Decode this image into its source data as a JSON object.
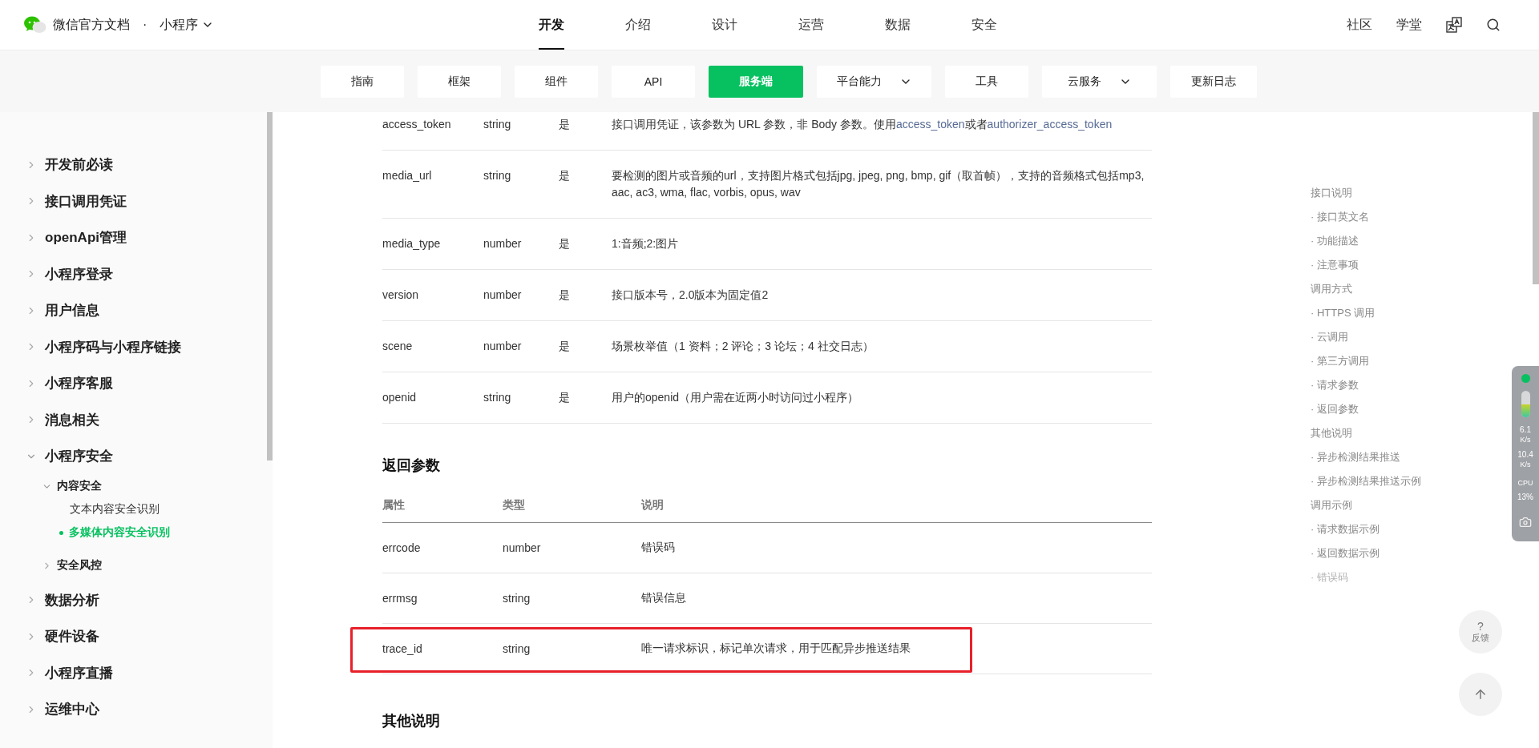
{
  "header": {
    "site_title": "微信官方文档",
    "separator": "·",
    "product": "小程序",
    "nav": [
      {
        "label": "开发",
        "selected": true
      },
      {
        "label": "介绍",
        "selected": false
      },
      {
        "label": "设计",
        "selected": false
      },
      {
        "label": "运营",
        "selected": false
      },
      {
        "label": "数据",
        "selected": false
      },
      {
        "label": "安全",
        "selected": false
      }
    ],
    "links": [
      "社区",
      "学堂"
    ]
  },
  "subnav": [
    {
      "label": "指南",
      "selected": false,
      "dropdown": false
    },
    {
      "label": "框架",
      "selected": false,
      "dropdown": false
    },
    {
      "label": "组件",
      "selected": false,
      "dropdown": false
    },
    {
      "label": "API",
      "selected": false,
      "dropdown": false
    },
    {
      "label": "服务端",
      "selected": true,
      "dropdown": false
    },
    {
      "label": "平台能力",
      "selected": false,
      "dropdown": true
    },
    {
      "label": "工具",
      "selected": false,
      "dropdown": false
    },
    {
      "label": "云服务",
      "selected": false,
      "dropdown": true
    },
    {
      "label": "更新日志",
      "selected": false,
      "dropdown": false
    }
  ],
  "sidebar": {
    "items": [
      {
        "label": "开发前必读",
        "expanded": false
      },
      {
        "label": "接口调用凭证",
        "expanded": false
      },
      {
        "label": "openApi管理",
        "expanded": false
      },
      {
        "label": "小程序登录",
        "expanded": false
      },
      {
        "label": "用户信息",
        "expanded": false
      },
      {
        "label": "小程序码与小程序链接",
        "expanded": false
      },
      {
        "label": "小程序客服",
        "expanded": false
      },
      {
        "label": "消息相关",
        "expanded": false
      },
      {
        "label": "小程序安全",
        "expanded": true,
        "children": [
          {
            "label": "内容安全",
            "expanded": true,
            "children": [
              {
                "label": "文本内容安全识别",
                "selected": false
              },
              {
                "label": "多媒体内容安全识别",
                "selected": true
              }
            ]
          },
          {
            "label": "安全风控",
            "expanded": false
          }
        ]
      },
      {
        "label": "数据分析",
        "expanded": false
      },
      {
        "label": "硬件设备",
        "expanded": false
      },
      {
        "label": "小程序直播",
        "expanded": false
      },
      {
        "label": "运维中心",
        "expanded": false
      }
    ]
  },
  "request_table": {
    "rows": [
      {
        "name": "access_token",
        "type": "string",
        "required": "是",
        "description_parts": [
          {
            "kind": "text",
            "text": "接口调用凭证，该参数为 URL 参数，非 Body 参数。使用"
          },
          {
            "kind": "link",
            "text": "access_token"
          },
          {
            "kind": "text",
            "text": "或者"
          },
          {
            "kind": "link",
            "text": "authorizer_access_token"
          }
        ]
      },
      {
        "name": "media_url",
        "type": "string",
        "required": "是",
        "description": "要检测的图片或音频的url，支持图片格式包括jpg, jpeg, png, bmp, gif（取首帧），支持的音频格式包括mp3, aac, ac3, wma, flac, vorbis, opus, wav"
      },
      {
        "name": "media_type",
        "type": "number",
        "required": "是",
        "description": "1:音频;2:图片"
      },
      {
        "name": "version",
        "type": "number",
        "required": "是",
        "description": "接口版本号，2.0版本为固定值2"
      },
      {
        "name": "scene",
        "type": "number",
        "required": "是",
        "description": "场景枚举值（1 资料；2 评论；3 论坛；4 社交日志）"
      },
      {
        "name": "openid",
        "type": "string",
        "required": "是",
        "description": "用户的openid（用户需在近两小时访问过小程序）"
      }
    ]
  },
  "return_section": {
    "title": "返回参数",
    "columns": [
      "属性",
      "类型",
      "说明"
    ],
    "rows": [
      {
        "name": "errcode",
        "type": "number",
        "description": "错误码",
        "highlighted": false
      },
      {
        "name": "errmsg",
        "type": "string",
        "description": "错误信息",
        "highlighted": false
      },
      {
        "name": "trace_id",
        "type": "string",
        "description": "唯一请求标识，标记单次请求，用于匹配异步推送结果",
        "highlighted": true
      }
    ]
  },
  "other_section": {
    "title": "其他说明"
  },
  "toc": [
    {
      "label": "接口说明",
      "faded": false
    },
    {
      "label": "· 接口英文名",
      "faded": false
    },
    {
      "label": "· 功能描述",
      "faded": false
    },
    {
      "label": "· 注意事项",
      "faded": false
    },
    {
      "label": "调用方式",
      "faded": false
    },
    {
      "label": "· HTTPS 调用",
      "faded": false
    },
    {
      "label": "· 云调用",
      "faded": false
    },
    {
      "label": "· 第三方调用",
      "faded": false
    },
    {
      "label": "· 请求参数",
      "faded": false
    },
    {
      "label": "· 返回参数",
      "faded": false
    },
    {
      "label": "其他说明",
      "faded": false
    },
    {
      "label": "· 异步检测结果推送",
      "faded": false
    },
    {
      "label": "· 异步检测结果推送示例",
      "faded": false
    },
    {
      "label": "调用示例",
      "faded": false
    },
    {
      "label": "· 请求数据示例",
      "faded": false
    },
    {
      "label": "· 返回数据示例",
      "faded": false
    },
    {
      "label": "· 错误码",
      "faded": true
    }
  ],
  "monitor": {
    "upload": "6.1",
    "upload_unit": "K/s",
    "download": "10.4",
    "download_unit": "K/s",
    "cpu_label": "CPU",
    "cpu": "13%"
  },
  "feedback": {
    "icon": "?",
    "label": "反馈"
  }
}
